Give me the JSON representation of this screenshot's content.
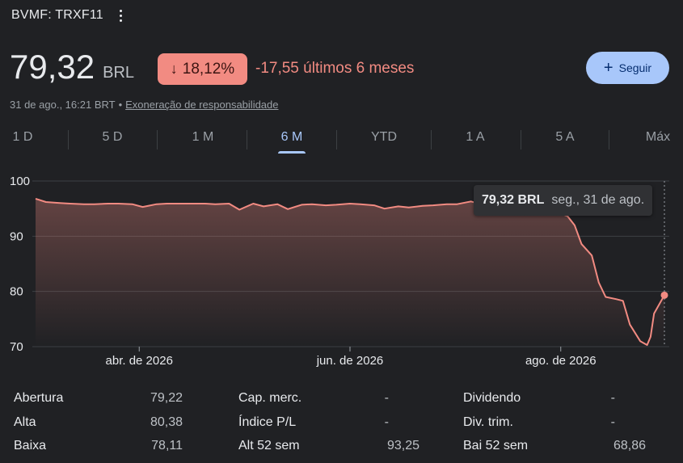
{
  "header": {
    "ticker": "BVMF: TRXF11"
  },
  "quote": {
    "price": "79,32",
    "currency": "BRL",
    "change_pct": "18,12%",
    "change_abs": "-17,55 últimos 6 meses",
    "timestamp": "31 de ago., 16:21 BRT",
    "separator": "•",
    "disclaimer": "Exoneração de responsabilidade"
  },
  "follow_button": {
    "label": "Seguir"
  },
  "tabs": [
    {
      "label": "1 D",
      "active": false
    },
    {
      "label": "5 D",
      "active": false
    },
    {
      "label": "1 M",
      "active": false
    },
    {
      "label": "6 M",
      "active": true
    },
    {
      "label": "YTD",
      "active": false
    },
    {
      "label": "1 A",
      "active": false
    },
    {
      "label": "5 A",
      "active": false
    },
    {
      "label": "Máx",
      "active": false
    }
  ],
  "tooltip": {
    "price": "79,32 BRL",
    "date": "seg., 31 de ago."
  },
  "colors": {
    "line": "#f28b82",
    "accent": "#a8c7fa",
    "grid": "#3c4043",
    "background": "#202124"
  },
  "chart_data": {
    "type": "area",
    "y_ticks": [
      "100",
      "90",
      "80",
      "70"
    ],
    "ylim": [
      70,
      100
    ],
    "x_ticks": [
      {
        "label": "abr. de 2026",
        "date": "2026-04-01"
      },
      {
        "label": "jun. de 2026",
        "date": "2026-06-01"
      },
      {
        "label": "ago. de 2026",
        "date": "2026-08-01"
      }
    ],
    "x_range": [
      "2026-03-02",
      "2026-08-31"
    ],
    "grid": true,
    "series": [
      {
        "x": [
          "2026-03-02",
          "2026-03-05",
          "2026-03-09",
          "2026-03-12",
          "2026-03-16",
          "2026-03-19",
          "2026-03-23",
          "2026-03-26",
          "2026-03-30",
          "2026-04-02",
          "2026-04-06",
          "2026-04-09",
          "2026-04-13",
          "2026-04-16",
          "2026-04-20",
          "2026-04-23",
          "2026-04-27",
          "2026-04-30",
          "2026-05-04",
          "2026-05-07",
          "2026-05-11",
          "2026-05-14",
          "2026-05-18",
          "2026-05-21",
          "2026-05-25",
          "2026-05-28",
          "2026-06-01",
          "2026-06-04",
          "2026-06-08",
          "2026-06-11",
          "2026-06-15",
          "2026-06-18",
          "2026-06-22",
          "2026-06-25",
          "2026-06-29",
          "2026-07-02",
          "2026-07-06",
          "2026-07-09",
          "2026-07-13",
          "2026-07-16",
          "2026-07-20",
          "2026-07-23",
          "2026-07-27",
          "2026-07-30",
          "2026-08-03",
          "2026-08-05",
          "2026-08-07",
          "2026-08-10",
          "2026-08-12",
          "2026-08-14",
          "2026-08-17",
          "2026-08-19",
          "2026-08-21",
          "2026-08-24",
          "2026-08-26",
          "2026-08-27",
          "2026-08-28",
          "2026-08-31"
        ],
        "y": [
          96.8,
          96.2,
          96.0,
          95.9,
          95.8,
          95.8,
          95.9,
          95.9,
          95.8,
          95.3,
          95.8,
          95.9,
          95.9,
          95.9,
          95.9,
          95.8,
          95.9,
          94.8,
          95.9,
          95.4,
          95.8,
          94.9,
          95.7,
          95.8,
          95.6,
          95.7,
          95.9,
          95.8,
          95.6,
          95.0,
          95.4,
          95.2,
          95.5,
          95.6,
          95.8,
          95.8,
          96.3,
          95.8,
          95.7,
          95.6,
          95.4,
          95.6,
          95.2,
          94.6,
          93.6,
          92.0,
          88.6,
          86.5,
          81.6,
          79.0,
          78.6,
          78.3,
          74.0,
          71.0,
          70.3,
          71.8,
          76.0,
          79.32
        ]
      }
    ]
  },
  "stats": [
    {
      "label": "Abertura",
      "value": "79,22"
    },
    {
      "label": "Alta",
      "value": "80,38"
    },
    {
      "label": "Baixa",
      "value": "78,11"
    },
    {
      "label": "Cap. merc.",
      "value": "-"
    },
    {
      "label": "Índice P/L",
      "value": "-"
    },
    {
      "label": "Alt 52 sem",
      "value": "93,25"
    },
    {
      "label": "Dividendo",
      "value": "-"
    },
    {
      "label": "Div. trim.",
      "value": "-"
    },
    {
      "label": "Bai 52 sem",
      "value": "68,86"
    }
  ]
}
